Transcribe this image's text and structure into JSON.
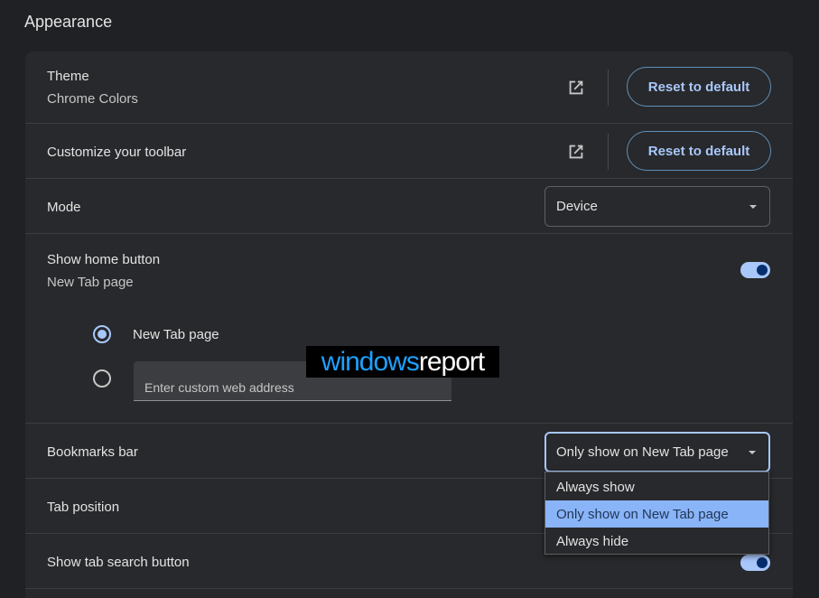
{
  "section": {
    "title": "Appearance"
  },
  "theme": {
    "label": "Theme",
    "value": "Chrome Colors",
    "reset_label": "Reset to default"
  },
  "toolbar": {
    "label": "Customize your toolbar",
    "reset_label": "Reset to default"
  },
  "mode": {
    "label": "Mode",
    "selected": "Device"
  },
  "home_button": {
    "label": "Show home button",
    "sublabel": "New Tab page",
    "enabled": true,
    "options": {
      "new_tab_label": "New Tab page",
      "custom_placeholder": "Enter custom web address"
    }
  },
  "bookmarks_bar": {
    "label": "Bookmarks bar",
    "selected": "Only show on New Tab page",
    "menu_options": [
      "Always show",
      "Only show on New Tab page",
      "Always hide"
    ]
  },
  "tab_position": {
    "label": "Tab position"
  },
  "tab_search": {
    "label": "Show tab search button",
    "enabled": true
  },
  "watermark": {
    "part1": "windows",
    "part2": "report"
  },
  "icons": {
    "external_link": "open-in-new-icon",
    "dropdown": "caret-down-icon"
  },
  "colors": {
    "background": "#202124",
    "card": "#28292c",
    "accent": "#a8c7fa",
    "menu_highlight": "#8ab4f8"
  }
}
